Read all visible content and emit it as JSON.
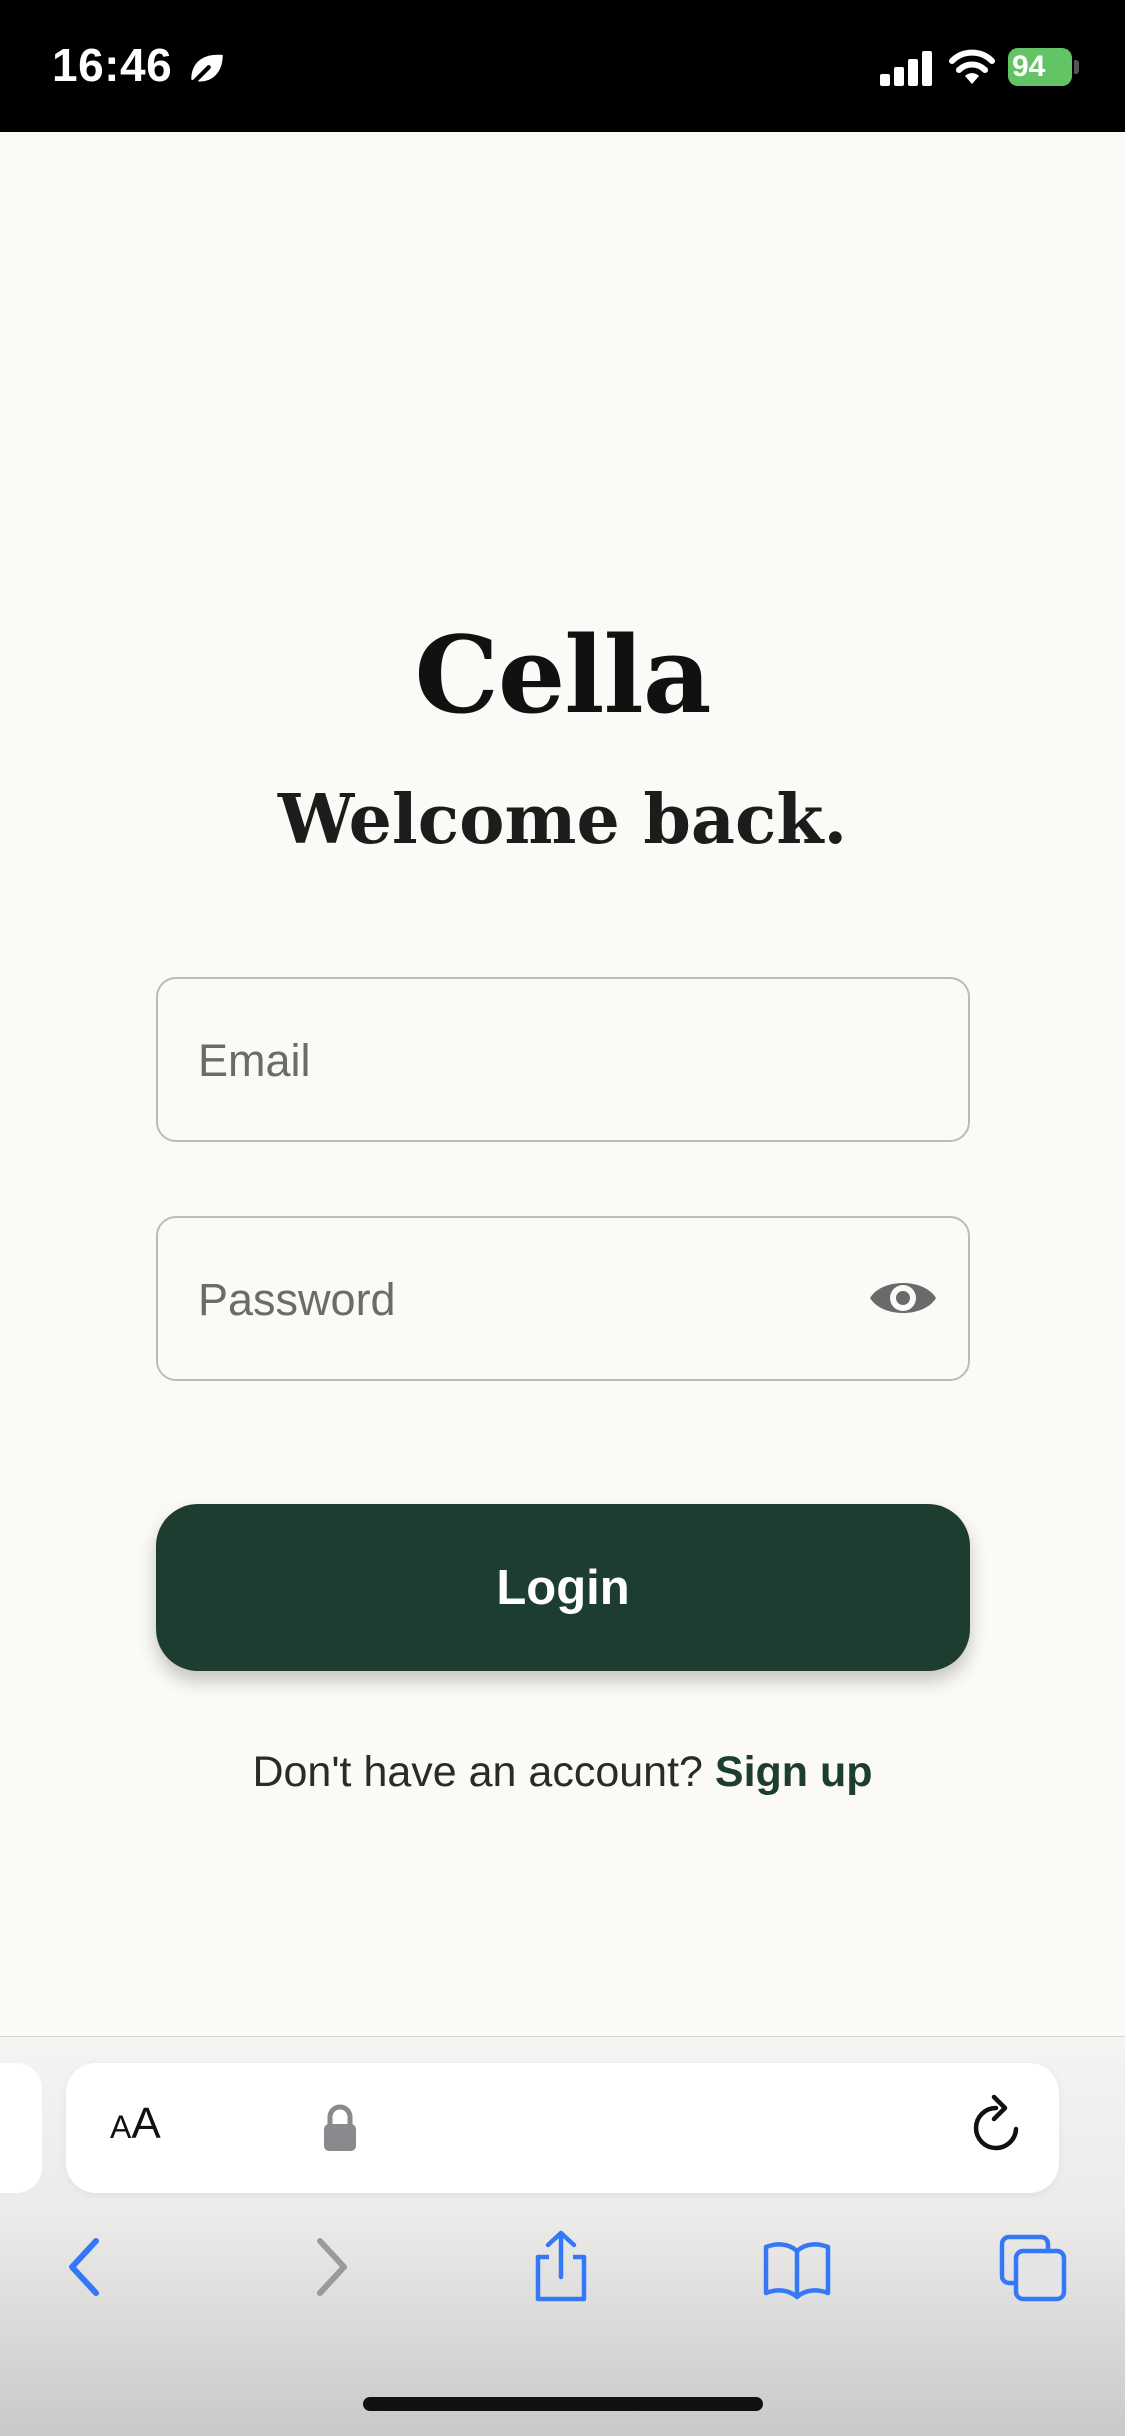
{
  "status_bar": {
    "time": "16:46",
    "battery": "94",
    "battery_color": "#63c466",
    "icons": [
      "focus-leaf-icon",
      "cellular-signal-icon",
      "wifi-icon",
      "battery-charging-icon"
    ]
  },
  "login": {
    "brand": "Cella",
    "heading": "Welcome back.",
    "email_placeholder": "Email",
    "password_placeholder": "Password",
    "login_label": "Login",
    "signup_prompt": "Don't have an account?",
    "signup_link": "Sign up",
    "accent_color": "#1e3d31",
    "background_color": "#fbfaf6"
  },
  "browser": {
    "aa_small": "A",
    "aa_large": "A",
    "toolbar_icons": [
      "back-icon",
      "forward-icon",
      "share-icon",
      "bookmarks-icon",
      "tabs-icon"
    ],
    "accent_color": "#3478f6"
  }
}
